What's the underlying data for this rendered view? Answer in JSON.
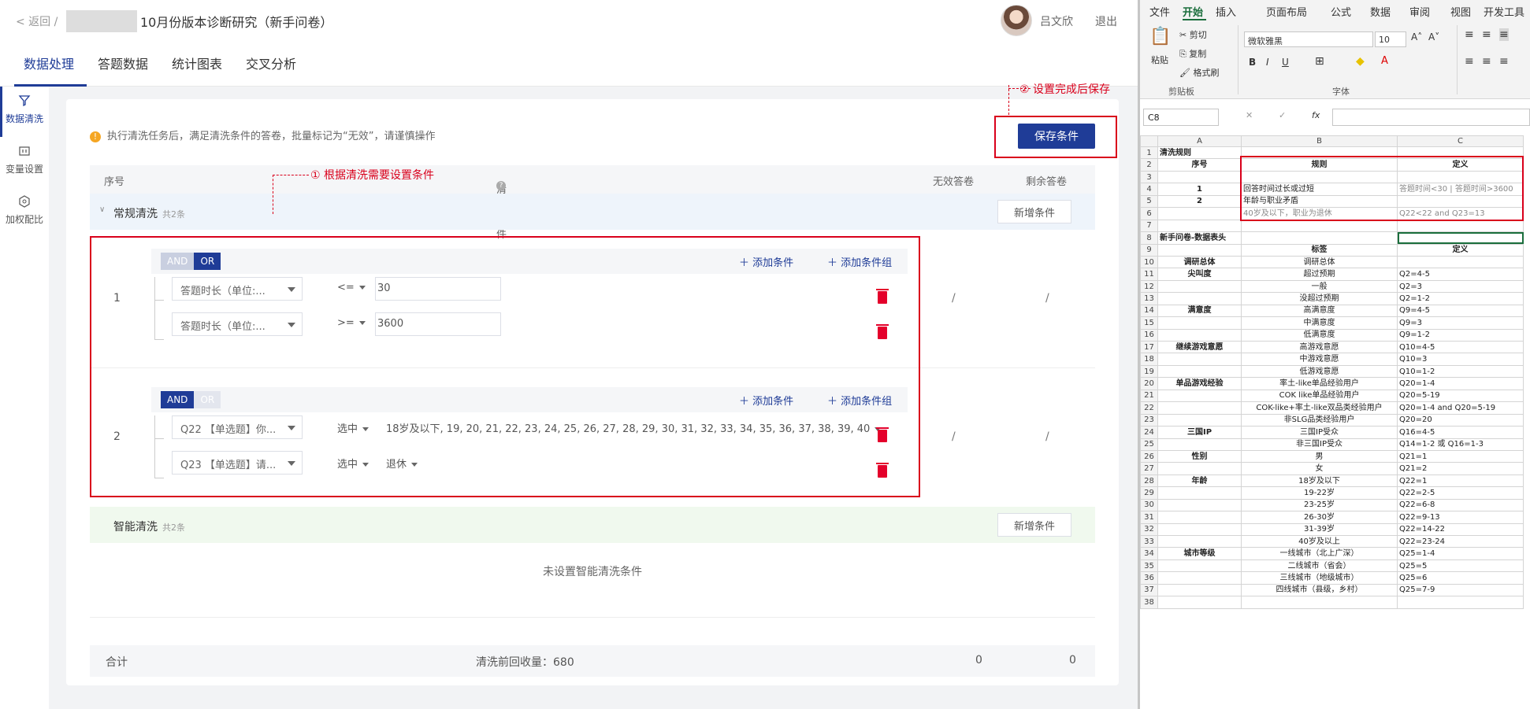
{
  "topbar": {
    "back": "< 返回 /",
    "title": "10月份版本诊断研究（新手问卷）",
    "user": "吕文欣",
    "logout": "退出"
  },
  "tabs": [
    "数据处理",
    "答题数据",
    "统计图表",
    "交叉分析"
  ],
  "sidebar": [
    {
      "label": "数据清洗",
      "icon": "filter-icon"
    },
    {
      "label": "变量设置",
      "icon": "variable-icon"
    },
    {
      "label": "加权配比",
      "icon": "weight-icon"
    }
  ],
  "warning": "执行清洗任务后，满足清洗条件的答卷，批量标记为“无效”，请谨慎操作",
  "save_button": "保存条件",
  "annotations": {
    "save": "②  设置完成后保存",
    "cond": "①  根据清洗需要设置条件"
  },
  "table_headers": {
    "no": "序号",
    "cond": "清洗条件",
    "invalid": "无效答卷",
    "remain": "剩余答卷"
  },
  "regular": {
    "title": "常规清洗",
    "count": "共2条",
    "new_btn": "新增条件"
  },
  "toggle": {
    "and": "AND",
    "or": "OR"
  },
  "add_cond": "添加条件",
  "add_group": "添加条件组",
  "rule1": {
    "no": "1",
    "c1": {
      "field": "答题时长（单位:...",
      "op": "<=",
      "value": "30"
    },
    "c2": {
      "field": "答题时长（单位:...",
      "op": ">=",
      "value": "3600"
    },
    "invalid": "/",
    "remain": "/"
  },
  "rule2": {
    "no": "2",
    "c1": {
      "field": "Q22 【单选题】你...",
      "op": "选中",
      "value": "18岁及以下, 19, 20, 21, 22, 23, 24, 25, 26, 27, 28, 29, 30, 31, 32, 33, 34, 35, 36, 37, 38, 39, 40"
    },
    "c2": {
      "field": "Q23 【单选题】请...",
      "op": "选中",
      "value": "退休"
    },
    "invalid": "/",
    "remain": "/"
  },
  "smart": {
    "title": "智能清洗",
    "count": "共2条",
    "new_btn": "新增条件",
    "empty": "未设置智能清洗条件"
  },
  "total": {
    "label": "合计",
    "pre": "清洗前回收量：680",
    "invalid": "0",
    "remain": "0"
  },
  "excel": {
    "menu": [
      "文件",
      "开始",
      "插入",
      "页面布局",
      "公式",
      "数据",
      "审阅",
      "视图",
      "开发工具"
    ],
    "ribbon": {
      "paste": "粘贴",
      "cut": "剪切",
      "copy": "复制",
      "format": "格式刷",
      "clipboard": "剪贴板",
      "font": "微软雅黑",
      "size": "10",
      "font_group": "字体",
      "grow": "A˄",
      "shrink": "A˅",
      "bold": "B",
      "italic": "I",
      "underline": "U"
    },
    "namebox": "C8",
    "cols": [
      "A",
      "B",
      "C"
    ],
    "rows": [
      [
        "1",
        "清洗规则",
        "",
        ""
      ],
      [
        "2",
        "序号",
        "规则",
        "定义"
      ],
      [
        "3",
        "",
        "",
        ""
      ],
      [
        "4",
        "1",
        "回答时间过长或过短",
        "答题时间<30 | 答题时间>3600"
      ],
      [
        "5",
        "2",
        "年龄与职业矛盾",
        ""
      ],
      [
        "6",
        "",
        "40岁及以下，职业为退休",
        "Q22<22 and Q23=13"
      ],
      [
        "7",
        "",
        "",
        ""
      ],
      [
        "8",
        "新手问卷-数据表头",
        "",
        ""
      ],
      [
        "9",
        "",
        "标签",
        "定义"
      ],
      [
        "10",
        "调研总体",
        "调研总体",
        ""
      ],
      [
        "11",
        "尖叫度",
        "超过预期",
        "Q2=4-5"
      ],
      [
        "12",
        "",
        "一般",
        "Q2=3"
      ],
      [
        "13",
        "",
        "没超过预期",
        "Q2=1-2"
      ],
      [
        "14",
        "满意度",
        "高满意度",
        "Q9=4-5"
      ],
      [
        "15",
        "",
        "中满意度",
        "Q9=3"
      ],
      [
        "16",
        "",
        "低满意度",
        "Q9=1-2"
      ],
      [
        "17",
        "继续游戏意愿",
        "高游戏意愿",
        "Q10=4-5"
      ],
      [
        "18",
        "",
        "中游戏意愿",
        "Q10=3"
      ],
      [
        "19",
        "",
        "低游戏意愿",
        "Q10=1-2"
      ],
      [
        "20",
        "单品游戏经验",
        "率土-like单品经验用户",
        "Q20=1-4"
      ],
      [
        "21",
        "",
        "COK like单品经验用户",
        "Q20=5-19"
      ],
      [
        "22",
        "",
        "COK-like+率土-like双品类经验用户",
        "Q20=1-4 and Q20=5-19"
      ],
      [
        "23",
        "",
        "非SLG品类经验用户",
        "Q20=20"
      ],
      [
        "24",
        "三国IP",
        "三国IP受众",
        "Q16=4-5"
      ],
      [
        "25",
        "",
        "非三国IP受众",
        "Q14=1-2 或 Q16=1-3"
      ],
      [
        "26",
        "性别",
        "男",
        "Q21=1"
      ],
      [
        "27",
        "",
        "女",
        "Q21=2"
      ],
      [
        "28",
        "年龄",
        "18岁及以下",
        "Q22=1"
      ],
      [
        "29",
        "",
        "19-22岁",
        "Q22=2-5"
      ],
      [
        "30",
        "",
        "23-25岁",
        "Q22=6-8"
      ],
      [
        "31",
        "",
        "26-30岁",
        "Q22=9-13"
      ],
      [
        "32",
        "",
        "31-39岁",
        "Q22=14-22"
      ],
      [
        "33",
        "",
        "40岁及以上",
        "Q22=23-24"
      ],
      [
        "34",
        "城市等级",
        "一线城市（北上广深）",
        "Q25=1-4"
      ],
      [
        "35",
        "",
        "二线城市（省会）",
        "Q25=5"
      ],
      [
        "36",
        "",
        "三线城市（地级城市）",
        "Q25=6"
      ],
      [
        "37",
        "",
        "四线城市（县级，乡村）",
        "Q25=7-9"
      ],
      [
        "38",
        "",
        "",
        ""
      ]
    ]
  }
}
